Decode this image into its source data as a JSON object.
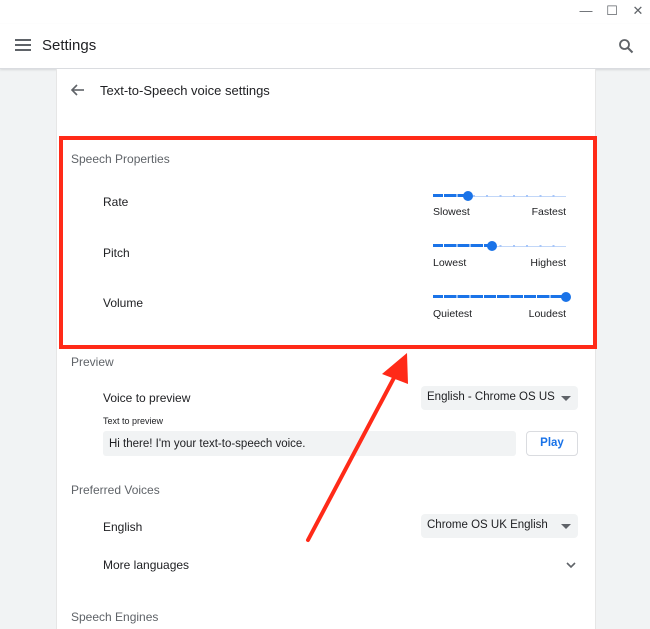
{
  "window": {
    "minimize_glyph": "—",
    "maximize_glyph": "☐",
    "close_glyph": "✕"
  },
  "app": {
    "title": "Settings"
  },
  "page": {
    "subtitle": "Text-to-Speech voice settings"
  },
  "speech_properties": {
    "header": "Speech Properties",
    "rate": {
      "label": "Rate",
      "min_label": "Slowest",
      "max_label": "Fastest",
      "value": 0.26
    },
    "pitch": {
      "label": "Pitch",
      "min_label": "Lowest",
      "max_label": "Highest",
      "value": 0.44
    },
    "volume": {
      "label": "Volume",
      "min_label": "Quietest",
      "max_label": "Loudest",
      "value": 1.0
    }
  },
  "preview": {
    "header": "Preview",
    "voice_label": "Voice to preview",
    "voice_selected": "English - Chrome OS US English",
    "text_label": "Text to preview",
    "text_value": "Hi there! I'm your text-to-speech voice.",
    "play_label": "Play"
  },
  "preferred_voices": {
    "header": "Preferred Voices",
    "english_label": "English",
    "english_selected": "Chrome OS UK English",
    "more_languages_label": "More languages"
  },
  "speech_engines": {
    "header": "Speech Engines"
  },
  "colors": {
    "accent": "#1a73e8",
    "highlight": "#ff2a18"
  },
  "icons": {
    "menu": "menu-icon",
    "search": "search-icon",
    "back": "arrow-back-icon",
    "dropdown": "caret-down-icon",
    "expand": "chevron-down-icon"
  }
}
